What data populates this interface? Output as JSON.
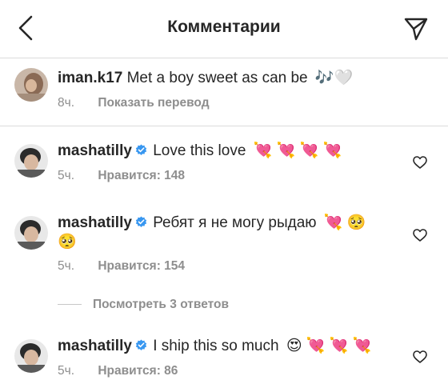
{
  "header": {
    "title": "Комментарии"
  },
  "caption": {
    "username": "iman.k17",
    "text": "Met a boy sweet as can be",
    "emoji": "🎶🤍",
    "time": "8ч.",
    "translate_label": "Показать перевод"
  },
  "comments": [
    {
      "username": "mashatilly",
      "text": "Love this love",
      "emoji": "💘 💘 💘 💘",
      "emoji2": "",
      "time": "5ч.",
      "likes": "Нравится: 148"
    },
    {
      "username": "mashatilly",
      "text": "Ребят я не могу рыдаю",
      "emoji": "💘 🥺",
      "emoji2": "🥺",
      "time": "5ч.",
      "likes": "Нравится: 154"
    },
    {
      "username": "mashatilly",
      "text": "I ship this so much",
      "emoji": "😍 💘 💘 💘",
      "emoji2": "",
      "time": "5ч.",
      "likes": "Нравится: 86"
    }
  ],
  "view_replies_label": "Посмотреть 3 ответов",
  "colors": {
    "text": "#262626",
    "secondary": "#8e8e8e",
    "verified": "#3897f0",
    "divider": "#dbdbdb"
  },
  "icons": [
    "back-arrow-icon",
    "send-icon",
    "verified-badge-icon",
    "heart-icon"
  ]
}
